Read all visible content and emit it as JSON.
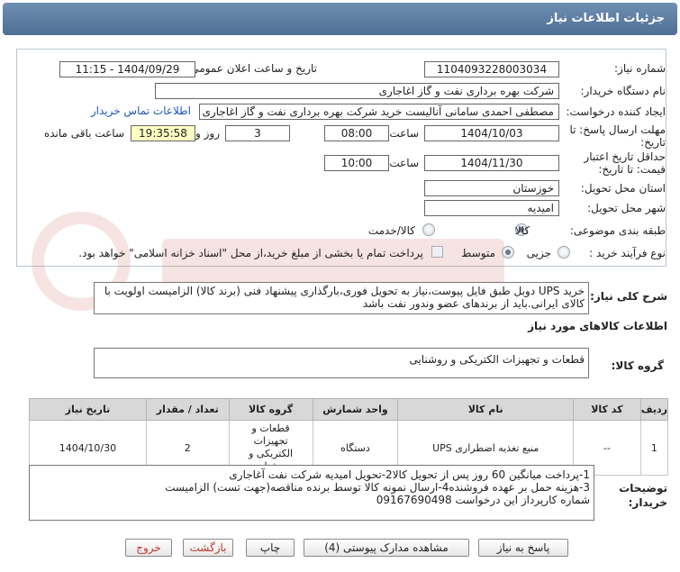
{
  "header": {
    "title": "جزئیات اطلاعات نیاز"
  },
  "form": {
    "need_number_label": "شماره نیاز:",
    "need_number": "1104093228003034",
    "announce_label": "تاریخ و ساعت اعلان عمومی:",
    "announce_value": "1404/09/29 - 11:15",
    "buyer_org_label": "نام دستگاه خریدار:",
    "buyer_org": "شرکت بهره برداری نفت و گاز اغاجاری",
    "creator_label": "ایجاد کننده درخواست:",
    "creator": "مصطفی احمدی سامانی آنالیست خرید شرکت بهره برداری نفت و گاز اغاجاری",
    "contact_link": "اطلاعات تماس خریدار",
    "reply_deadline_label": "مهلت ارسال پاسخ: تا تاریخ:",
    "reply_date": "1404/10/03",
    "time_label": "ساعت",
    "reply_time": "08:00",
    "days_value": "3",
    "days_label": "روز و",
    "remaining_time": "19:35:58",
    "remaining_label": "ساعت باقی مانده",
    "price_validity_label": "حداقل تاریخ اعتبار قیمت: تا تاریخ:",
    "validity_date": "1404/11/30",
    "validity_time": "10:00",
    "province_label": "استان محل تحویل:",
    "province": "خوزستان",
    "city_label": "شهر محل تحویل:",
    "city": "امیدیه",
    "category_label": "طبقه بندی موضوعی:",
    "category_options": [
      "کالا",
      "کالا/خدمت"
    ],
    "process_label": "نوع فرآیند خرید :",
    "process_options": [
      "جزیی",
      "متوسط"
    ],
    "treasury_note": "پرداخت تمام یا بخشی از مبلغ خرید،از محل \"اسناد خزانه اسلامی\" خواهد بود."
  },
  "summary": {
    "label": "شرح کلی نیاز:",
    "text": "خرید UPS دوبل طبق فایل پیوست،نیاز به تحویل فوری،بارگذاری پیشنهاد فنی (برند کالا) الزامیست اولویت با کالای ایرانی.باید از برندهای عضو وندور نفت باشد"
  },
  "goods_info": {
    "title": "اطلاعات کالاهای مورد نیاز",
    "group_label": "گروه کالا:",
    "group_value": "قطعات و تجهیزات الکتریکی و روشنایی"
  },
  "table": {
    "headers": [
      "ردیف",
      "کد کالا",
      "نام کالا",
      "واحد شمارش",
      "گروه کالا",
      "تعداد / مقدار",
      "تاریخ نیاز"
    ],
    "rows": [
      [
        "1",
        "--",
        "منبع تغذیه اضطراری UPS",
        "دستگاه",
        "قطعات و تجهیزات الکتریکی و روشنایی",
        "2",
        "1404/10/30"
      ]
    ]
  },
  "buyer_notes": {
    "label": "توضیحات خریدار:",
    "lines": [
      "1-پرداخت میانگین 60 روز پس از تحویل کالا2-تحویل امیدیه شرکت نفت آغاجاری",
      "3-هزینه حمل بر عهده فروشنده4-ارسال نمونه کالا توسط برنده مناقصه(جهت تست) الزامیست",
      "شماره کارپرداز این درخواست 09167690498"
    ]
  },
  "buttons": {
    "reply": "پاسخ به نیاز",
    "attachments": "مشاهده مدارک پیوستی (4)",
    "print": "چاپ",
    "back": "بازگشت",
    "exit": "خروج"
  }
}
